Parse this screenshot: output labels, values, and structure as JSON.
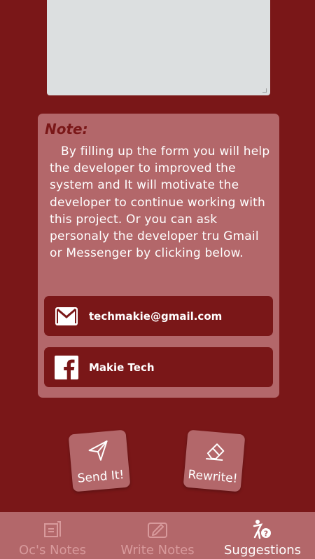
{
  "note": {
    "title": "Note:",
    "body": "By filling up the form you will help the developer to improved the system and It will motivate the developer to continue working with this project. Or you can ask personaly the developer tru Gmail or Messenger by clicking below."
  },
  "contacts": {
    "gmail_label": "techmakie@gmail.com",
    "facebook_label": "Makie Tech"
  },
  "actions": {
    "send_label": "Send It!",
    "rewrite_label": "Rewrite!"
  },
  "nav": {
    "items": [
      {
        "label": "Oc's Notes",
        "icon": "notes-icon"
      },
      {
        "label": "Write Notes",
        "icon": "write-icon"
      },
      {
        "label": "Suggestions",
        "icon": "suggestion-icon",
        "active": true
      }
    ]
  },
  "colors": {
    "background": "#7a1718",
    "card": "#b3676a",
    "textarea": "#dcdfe0",
    "nav_inactive": "#d89a9c",
    "nav_active": "#ffffff"
  }
}
